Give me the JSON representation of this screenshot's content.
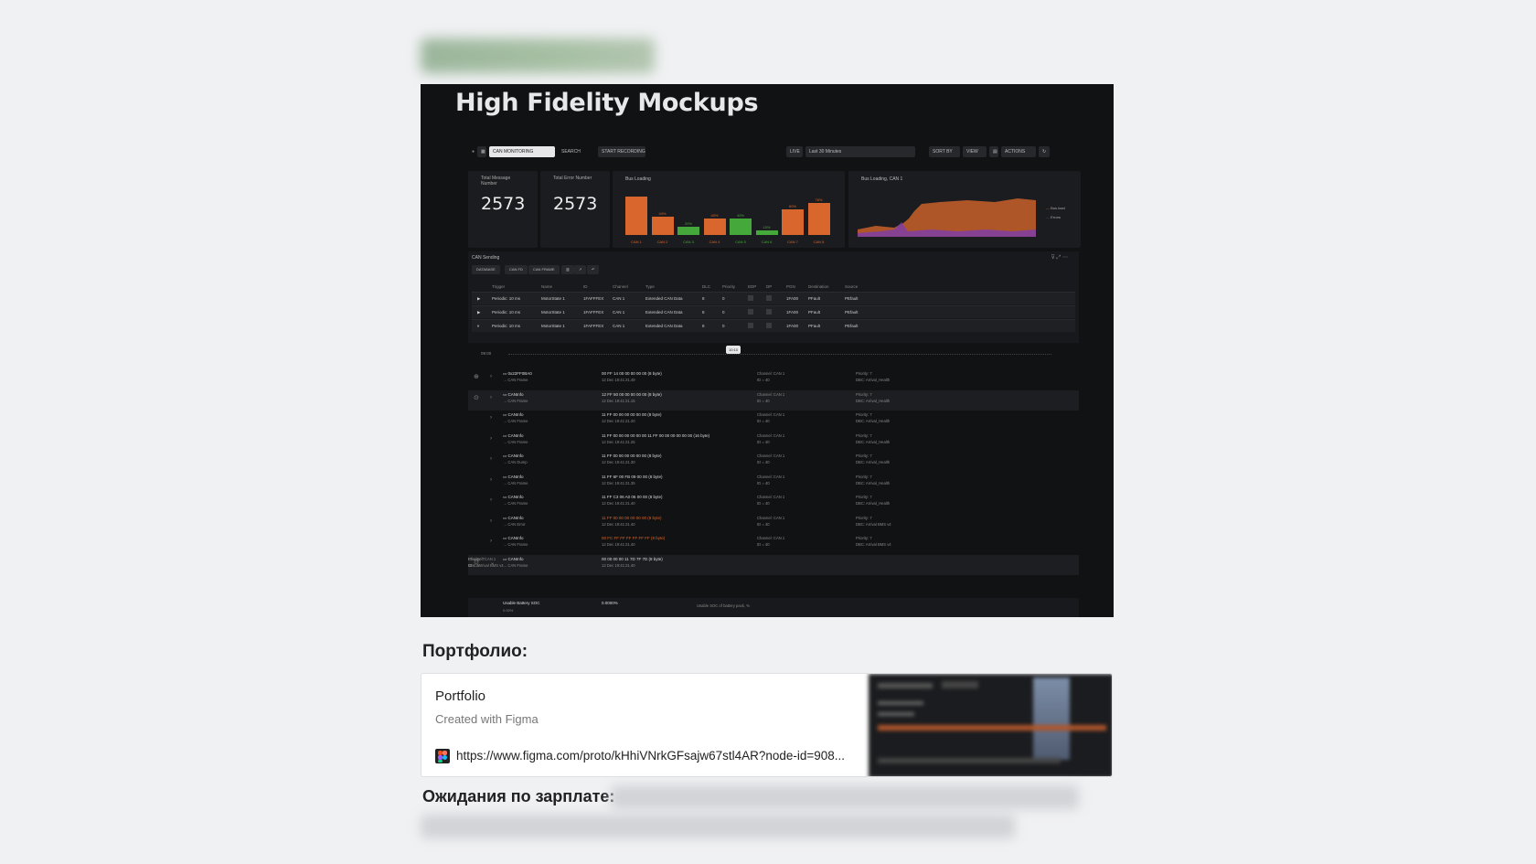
{
  "mockup": {
    "heading": "High Fidelity Mockups",
    "toolbar": {
      "dropdown": "CAN MONITORING",
      "search": "SEARCH",
      "start_recording": "START RECORDING",
      "live": "LIVE",
      "time_range": "Last 30 Minutes",
      "sort_by": "SORT BY",
      "view": "VIEW",
      "actions": "ACTIONS"
    },
    "cards": [
      {
        "label": "Total Message Number",
        "value": "2573"
      },
      {
        "label": "Total Error Number",
        "value": "2573"
      }
    ],
    "bus_loading_title": "Bus Loading",
    "bus_loading_can1_title": "Bus Loading, CAN 1",
    "area_legend": [
      "Bus load",
      "Errors"
    ],
    "sending": {
      "title": "CAN Sending",
      "tabs": [
        "DATABASE",
        "CAN FD",
        "CAN FRAME"
      ],
      "headers": [
        "Trigger",
        "Name",
        "ID",
        "Channel",
        "Type",
        "DLC",
        "Priority",
        "EDP",
        "DP",
        "PGN",
        "Destination",
        "Source"
      ],
      "rows": [
        [
          "Periodic: 10 ms",
          "MotorState 1",
          "1FAFFFEX",
          "CAN 1",
          "Extended CAN Data",
          "8",
          "0",
          "",
          "",
          "1FA00",
          "PFault",
          "PEfault"
        ],
        [
          "Periodic: 10 ms",
          "MotorState 1",
          "1FAFFFEX",
          "CAN 1",
          "Extended CAN Data",
          "8",
          "0",
          "",
          "",
          "1FA00",
          "PFault",
          "PEfault"
        ],
        [
          "Periodic: 10 ms",
          "MotorState 1",
          "1FAFFFEX",
          "CAN 1",
          "Extended CAN Data",
          "8",
          "0",
          "",
          "",
          "1FA00",
          "PFault",
          "PEfault"
        ]
      ]
    },
    "timeline": {
      "start": "09:00",
      "marker": "10:10"
    },
    "log": [
      {
        "name": "0x22FF0BA0",
        "type": "CAN Frame",
        "data": "00 FF 14 00 00 00 00 00 (8 byte)",
        "ts": "12 Dec 19:41:21.49",
        "channel": "Channel: CAN 1",
        "id": "ID = 40",
        "priority": "Priority: 7",
        "dbc": "DBC: Arrival_Health"
      },
      {
        "name": "CANInfo",
        "type": "CAN Frame",
        "data": "12 FF 50 00 00 00 00 00 (8 byte)",
        "ts": "12 Dec 19:41:21.15",
        "channel": "Channel: CAN 1",
        "id": "ID = 40",
        "priority": "Priority: 7",
        "dbc": "DBC: Arrival_Health"
      },
      {
        "name": "CANInfo",
        "type": "CAN Frame",
        "data": "11 FF 00 00 00 00 00 00 (8 byte)",
        "ts": "12 Dec 19:41:21.20",
        "channel": "Channel: CAN 1",
        "id": "ID = 40",
        "priority": "Priority: 7",
        "dbc": "DBC: Arrival_Health"
      },
      {
        "name": "CANInfo",
        "type": "CAN Frame",
        "data": "11 FF 00 00 00 00 00 00 11 FF 00 00 00 00 00 00 (16 byte)",
        "ts": "12 Dec 19:41:21.25",
        "channel": "Channel: CAN 1",
        "id": "ID = 40",
        "priority": "Priority: 7",
        "dbc": "DBC: Arrival_Health"
      },
      {
        "name": "CANInfo",
        "type": "CAN Dump",
        "data": "11 FF 00 00 00 00 00 00 (8 byte)",
        "ts": "12 Dec 19:41:21.30",
        "channel": "Channel: CAN 1",
        "id": "ID = 40",
        "priority": "Priority: 7",
        "dbc": "DBC: Arrival_Health"
      },
      {
        "name": "CANInfo",
        "type": "CAN Frame",
        "data": "11 FF 6F 00 FB 09 00 00 (8 byte)",
        "ts": "12 Dec 19:41:21.35",
        "channel": "Channel: CAN 1",
        "id": "ID = 40",
        "priority": "Priority: 7",
        "dbc": "DBC: Arrival_Health"
      },
      {
        "name": "CANInfo",
        "type": "CAN Frame",
        "data": "11 FF C3 06 A0 06 00 00 (8 byte)",
        "ts": "12 Dec 19:41:21.40",
        "channel": "Channel: CAN 1",
        "id": "ID = 40",
        "priority": "Priority: 7",
        "dbc": "DBC: Arrival_Health"
      },
      {
        "name": "CANInfo",
        "type": "CAN Error",
        "data": "11 FF 00 00 00 00 00 00 (8 byte)",
        "ts": "12 Dec 19:41:21.40",
        "channel": "Channel: CAN 1",
        "id": "ID = 40",
        "priority": "Priority: 7",
        "dbc": "DBC: Arrival BMS v4"
      },
      {
        "name": "CANInfo",
        "type": "CAN Frame",
        "data": "00 FC FF FF FF FF FF FF (8 byte)",
        "ts": "12 Dec 19:41:21.40",
        "channel": "Channel: CAN 1",
        "id": "ID = 40",
        "priority": "Priority: 7",
        "dbc": "DBC: Arrival BMS v4"
      },
      {
        "name": "CANInfo",
        "type": "CAN Frame",
        "data": "00 00 00 00 11 7D 7F 7D (8 byte)",
        "ts": "12 Dec 19:41:21.40",
        "channel": "Channel: CAN 1",
        "id": "ID = 40",
        "priority": "Priority: 7",
        "dbc": "DBC: Arrival BMS v4"
      }
    ],
    "expanded_signal": {
      "name": "Usable Battery SOC",
      "value": "0.0000%",
      "min": "0.00%",
      "desc": "Usable SOC of battery pack, %"
    }
  },
  "chart_data": {
    "type": "bar",
    "categories": [
      "CAN 1",
      "CAN 2",
      "CAN 3",
      "CAN 4",
      "CAN 5",
      "CAN 6",
      "CAN 7",
      "CAN 8"
    ],
    "values": [
      92,
      44,
      20,
      40,
      40,
      10,
      60,
      76
    ],
    "value_labels": [
      "",
      "44%",
      "20%",
      "40%",
      "40%",
      "10%",
      "60%",
      "76%"
    ],
    "colors": [
      "#d9662c",
      "#d9662c",
      "#45a83a",
      "#d9662c",
      "#45a83a",
      "#45a83a",
      "#d9662c",
      "#d9662c"
    ],
    "ylim": [
      0,
      100
    ]
  },
  "portfolio_heading": "Портфолио:",
  "portfolio_card": {
    "title": "Portfolio",
    "description": "Created with Figma",
    "url": "https://www.figma.com/proto/kHhiVNrkGFsajw67stl4AR?node-id=908..."
  },
  "salary_heading": "Ожидания по зарплате:"
}
